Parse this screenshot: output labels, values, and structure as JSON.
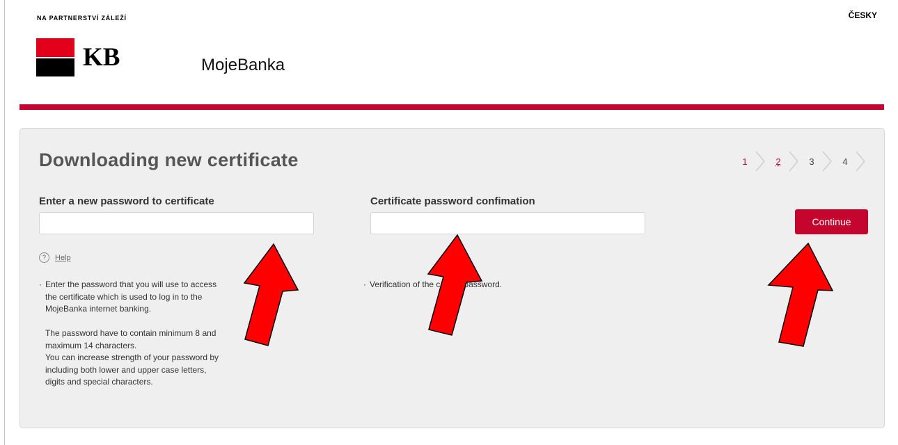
{
  "header": {
    "tagline": "NA PARTNERSTVÍ ZÁLEŽÍ",
    "language": "ČESKY",
    "logo_text": "KB",
    "app_name": "MojeBanka",
    "accent_color": "#c4052e",
    "logo_red": "#e2001a"
  },
  "main": {
    "title": "Downloading new certificate",
    "steps": [
      {
        "label": "1",
        "state": "done"
      },
      {
        "label": "2",
        "state": "current"
      },
      {
        "label": "3",
        "state": "todo"
      },
      {
        "label": "4",
        "state": "todo"
      }
    ],
    "new_password": {
      "label": "Enter a new password to certificate",
      "value": "",
      "placeholder": ""
    },
    "confirm_password": {
      "label": "Certificate password confimation",
      "value": "",
      "placeholder": ""
    },
    "continue_label": "Continue",
    "help": {
      "icon": "question-circle-icon",
      "label": "Help"
    },
    "help_text_password": "Enter the password that you will use to access\nthe certificate which is used to log in to the\nMojeBanka internet banking.\n\nThe password have to contain minimum 8 and\nmaximum 14 characters.\nYou can increase strength of your password by\nincluding both lower and upper case letters,\ndigits and special characters.",
    "help_text_confirm": "Verification of the correct password."
  },
  "annotations": {
    "arrow_color": "#ff0000",
    "arrow_outline": "#000000"
  }
}
